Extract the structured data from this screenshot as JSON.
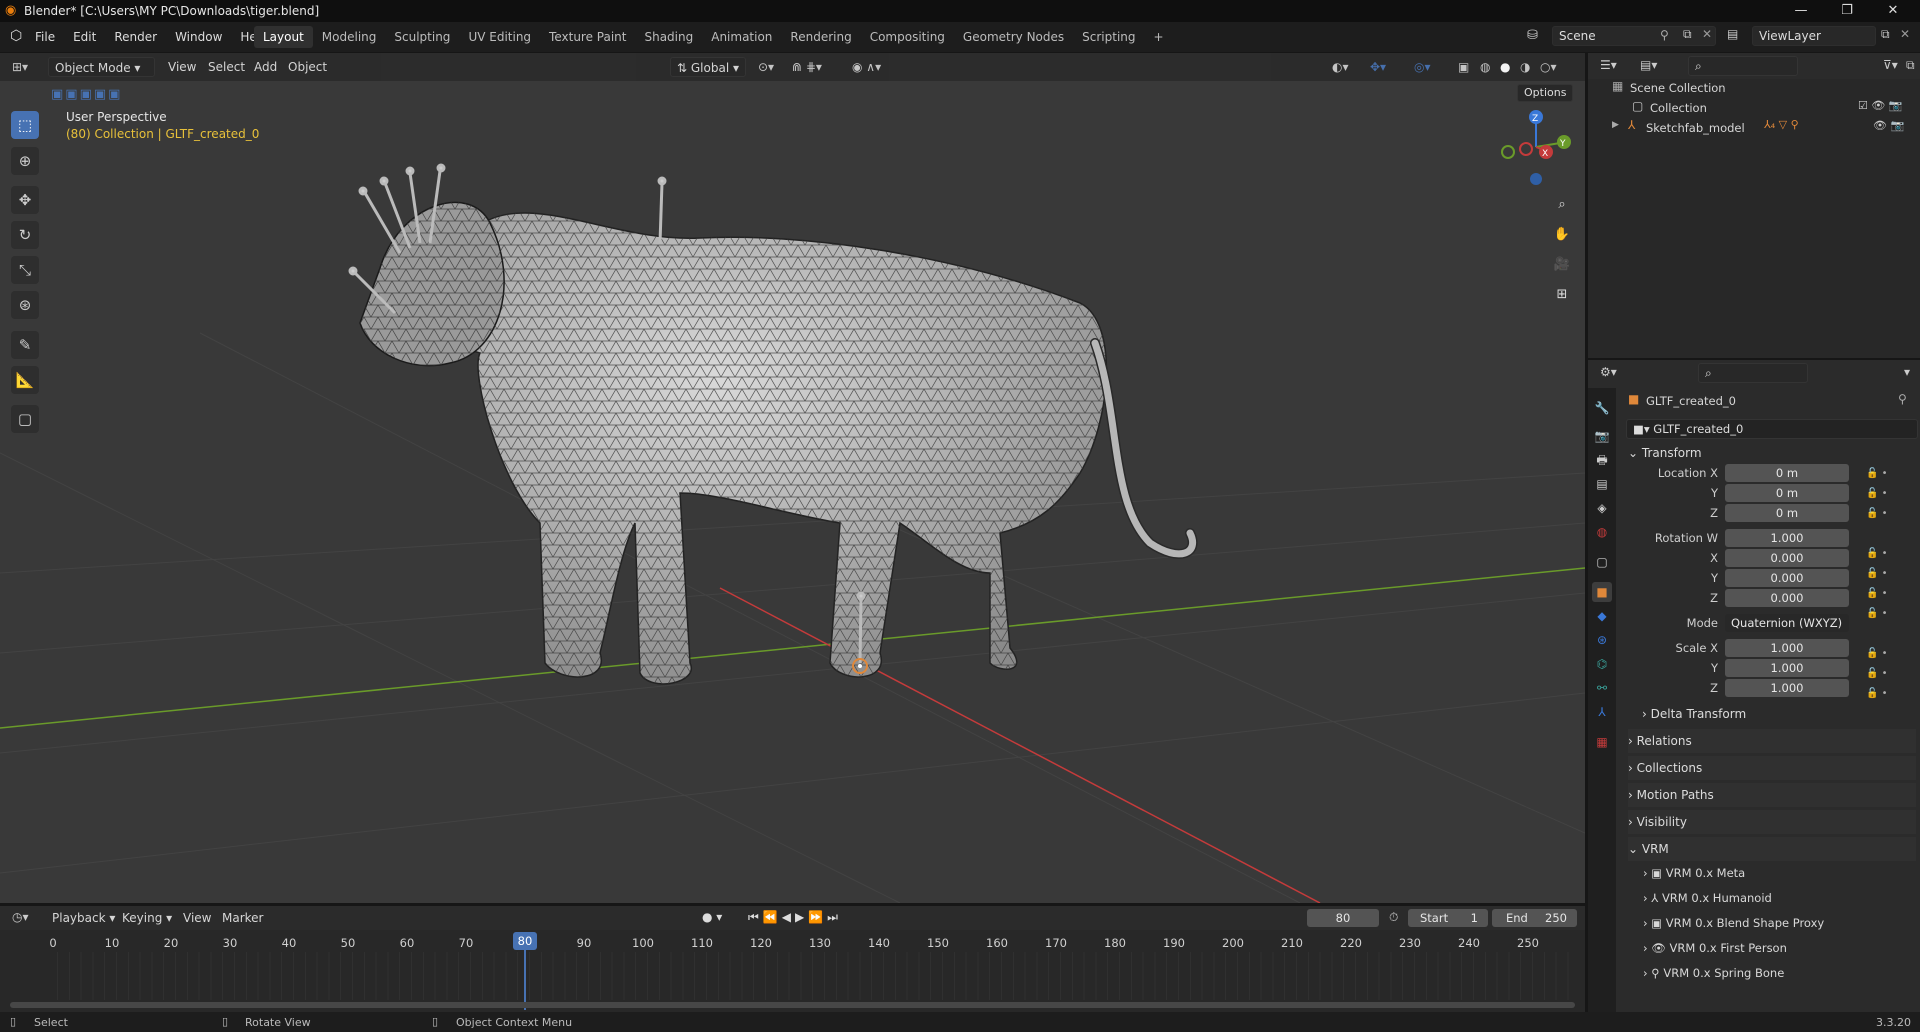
{
  "titlebar": {
    "title": "Blender* [C:\\Users\\MY PC\\Downloads\\tiger.blend]",
    "min": "—",
    "max": "❐",
    "close": "✕"
  },
  "menu": [
    "File",
    "Edit",
    "Render",
    "Window",
    "Help"
  ],
  "workspaces": [
    "Layout",
    "Modeling",
    "Sculpting",
    "UV Editing",
    "Texture Paint",
    "Shading",
    "Animation",
    "Rendering",
    "Compositing",
    "Geometry Nodes",
    "Scripting",
    "+"
  ],
  "scene": "Scene",
  "viewlayer": "ViewLayer",
  "viewport": {
    "mode": "Object Mode",
    "menus": [
      "View",
      "Select",
      "Add",
      "Object"
    ],
    "orientation": "Global",
    "options": "Options",
    "perspective_label": "User Perspective",
    "collection_label": "(80) Collection | GLTF_created_0",
    "gizmo": {
      "z": "Z",
      "y": "Y",
      "x": "X"
    }
  },
  "outliner": {
    "scene_collection": "Scene Collection",
    "collection": "Collection",
    "model": "Sketchfab_model"
  },
  "properties": {
    "object_name": "GLTF_created_0",
    "data_name": "GLTF_created_0",
    "transform_label": "Transform",
    "location": {
      "label": "Location X",
      "x": "0 m",
      "y": "0 m",
      "z": "0 m"
    },
    "rotation": {
      "label": "Rotation W",
      "w": "1.000",
      "x": "0.000",
      "y": "0.000",
      "z": "0.000"
    },
    "mode_label": "Mode",
    "mode_value": "Quaternion (WXYZ)",
    "scale": {
      "label": "Scale X",
      "x": "1.000",
      "y": "1.000",
      "z": "1.000"
    },
    "axis_y": "Y",
    "axis_x": "X",
    "axis_z": "Z",
    "delta": "Delta Transform",
    "panels": [
      "Relations",
      "Collections",
      "Motion Paths",
      "Visibility"
    ],
    "vrm": "VRM",
    "vrm_items": [
      "VRM 0.x Meta",
      "VRM 0.x Humanoid",
      "VRM 0.x Blend Shape Proxy",
      "VRM 0.x First Person",
      "VRM 0.x Spring Bone"
    ]
  },
  "timeline": {
    "menus": [
      "Playback",
      "Keying",
      "View",
      "Marker"
    ],
    "current_frame": "80",
    "start_label": "Start",
    "start": "1",
    "end_label": "End",
    "end": "250",
    "ticks": [
      "0",
      "10",
      "20",
      "30",
      "40",
      "50",
      "60",
      "70",
      "80",
      "90",
      "100",
      "110",
      "120",
      "130",
      "140",
      "150",
      "160",
      "170",
      "180",
      "190",
      "200",
      "210",
      "220",
      "230",
      "240",
      "250"
    ]
  },
  "status": {
    "select": "Select",
    "rotate": "Rotate View",
    "context": "Object Context Menu",
    "version": "3.3.20"
  },
  "colors": {
    "accent": "#4772b3",
    "active_frame": "#4772b3",
    "x_axis": "#c43b3b",
    "y_axis": "#6a9b2a",
    "z_axis": "#3a78d8",
    "object_icon": "#e0883a"
  }
}
